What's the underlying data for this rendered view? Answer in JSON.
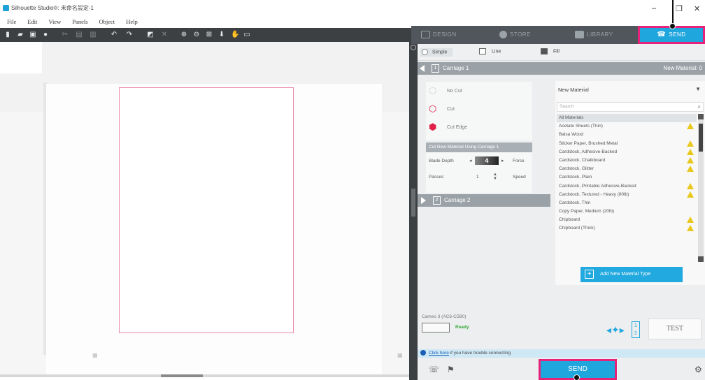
{
  "window": {
    "title": "Silhouette Studio®: 未命名設定-1",
    "controls": [
      "–",
      "❐",
      "✕"
    ]
  },
  "menu": [
    "File",
    "Edit",
    "View",
    "Panels",
    "Object",
    "Help"
  ],
  "toolbar_icons": [
    "new-icon",
    "open-icon",
    "save-icon",
    "library-icon",
    "cut-icon",
    "copy-icon",
    "paste-icon",
    "undo-icon",
    "redo-icon",
    "select-icon",
    "delete-icon",
    "zoom-in-icon",
    "zoom-out-icon",
    "zoom-fit-icon",
    "pan-down-icon",
    "hand-icon",
    "page-icon"
  ],
  "nav_tabs": {
    "design": "DESIGN",
    "store": "STORE",
    "library": "LIBRARY",
    "send": "SEND"
  },
  "modes": {
    "simple": "Simple",
    "line": "Line",
    "fill": "Fill"
  },
  "carriage1": {
    "number": "1",
    "label": "Carriage 1",
    "right_label": "New Material: 0"
  },
  "actions": {
    "no_cut": "No Cut",
    "cut": "Cut",
    "cut_edge": "Cut Edge"
  },
  "cut_settings": {
    "bar_label": "Cut New Material Using Carriage 1",
    "blade_depth_label": "Blade Depth",
    "blade_depth_value": "4",
    "force_label": "Force",
    "passes_label": "Passes",
    "passes_value": "1",
    "speed_label": "Speed"
  },
  "carriage2": {
    "number": "2",
    "label": "Carriage 2"
  },
  "material_panel": {
    "title": "New Material",
    "search_placeholder": "Search",
    "items": [
      {
        "name": "All Materials",
        "warn": false
      },
      {
        "name": "Acetate Sheets (Thin)",
        "warn": true
      },
      {
        "name": "Balsa Wood",
        "warn": false
      },
      {
        "name": "Sticker Paper, Brushed Metal",
        "warn": true
      },
      {
        "name": "Cardstock, Adhesive-Backed",
        "warn": true
      },
      {
        "name": "Cardstock, Chalkboard",
        "warn": true
      },
      {
        "name": "Cardstock, Glitter",
        "warn": true
      },
      {
        "name": "Cardstock, Plain",
        "warn": false
      },
      {
        "name": "Cardstock, Printable Adhesive-Backed",
        "warn": true
      },
      {
        "name": "Cardstock, Textured - Heavy (80lb)",
        "warn": true
      },
      {
        "name": "Cardstock, Thin",
        "warn": false
      },
      {
        "name": "Copy Paper, Medium (20lb)",
        "warn": false
      },
      {
        "name": "Chipboard",
        "warn": true
      },
      {
        "name": "Chipboard (Thick)",
        "warn": true
      }
    ],
    "add_button": "Add New Material Type"
  },
  "device": {
    "label": "Cameo 3 (AC6-C5B0)",
    "status": "Ready",
    "page_numbers": [
      "1",
      "2"
    ],
    "test_label": "TEST"
  },
  "help": {
    "link": "Click here",
    "text": " if you have trouble connecting"
  },
  "send_button": "SEND",
  "colors": {
    "accent": "#1fa6dd",
    "highlight": "#e8217a",
    "dark_toolbar": "#3d4043",
    "ready": "#35a83a",
    "warning": "#e9c81e"
  }
}
